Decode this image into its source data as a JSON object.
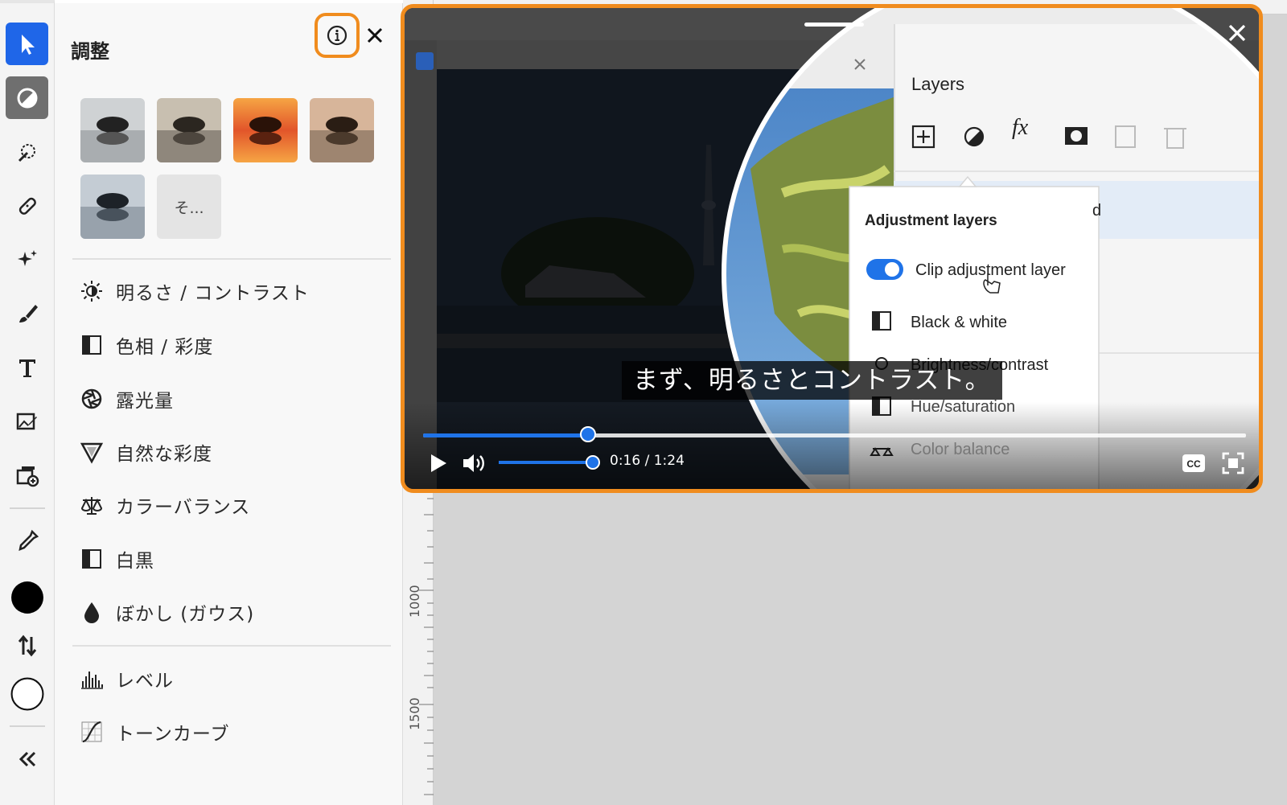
{
  "panel": {
    "title": "調整",
    "more_presets_label": "そ...",
    "adjustments": [
      {
        "icon": "sun-icon",
        "label": "明るさ / コントラスト"
      },
      {
        "icon": "half-square-icon",
        "label": "色相 / 彩度"
      },
      {
        "icon": "aperture-icon",
        "label": "露光量"
      },
      {
        "icon": "triangle-down-icon",
        "label": "自然な彩度"
      },
      {
        "icon": "balance-scale-icon",
        "label": "カラーバランス"
      },
      {
        "icon": "half-square-icon",
        "label": "白黒"
      },
      {
        "icon": "drop-icon",
        "label": "ぼかし (ガウス)"
      }
    ],
    "advanced": [
      {
        "icon": "histogram-icon",
        "label": "レベル"
      },
      {
        "icon": "curve-icon",
        "label": "トーンカーブ"
      }
    ]
  },
  "rulers": {
    "vertical_labels": [
      "1000",
      "1500"
    ]
  },
  "video": {
    "subtitle": "まず、明るさとコントラスト。",
    "time_display": "0:16 / 1:24",
    "progress_fraction": 0.2,
    "volume_fraction": 1.0,
    "cc_label": "CC",
    "layers_title": "Layers",
    "popover_title": "Adjustment layers",
    "popover_items": [
      "Clip adjustment layer",
      "Black & white",
      "Brightness/contrast",
      "Hue/saturation",
      "Color balance"
    ],
    "partial_text": "d",
    "accent": "#1f73e8"
  },
  "colors": {
    "highlight": "#f08c1e",
    "tool_selected": "#1f66e8"
  }
}
